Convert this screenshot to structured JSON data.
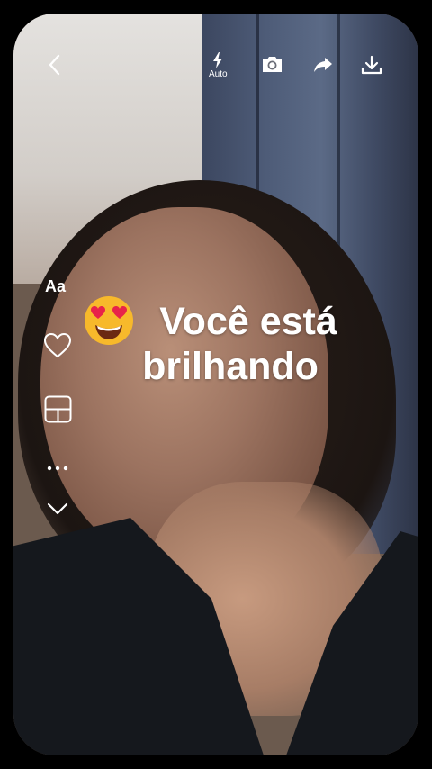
{
  "toolbar": {
    "back_icon": "chevron-left-icon",
    "flash_icon": "flash-icon",
    "flash_label": "Auto",
    "camera_icon": "camera-icon",
    "share_icon": "share-arrow-icon",
    "download_icon": "download-icon"
  },
  "caption": {
    "line1": "Você está",
    "line2": "brilhando",
    "emoji_icon": "heart-eyes-emoji"
  },
  "sidebar": {
    "text_label": "Aa",
    "items": [
      {
        "icon": "heart-icon"
      },
      {
        "icon": "layout-icon"
      },
      {
        "icon": "more-dots-icon"
      },
      {
        "icon": "chevron-down-icon"
      }
    ]
  },
  "colors": {
    "background": "#000000",
    "icon": "#ffffff",
    "emoji_face": "#f7b92b",
    "emoji_hearts": "#e8234a"
  }
}
